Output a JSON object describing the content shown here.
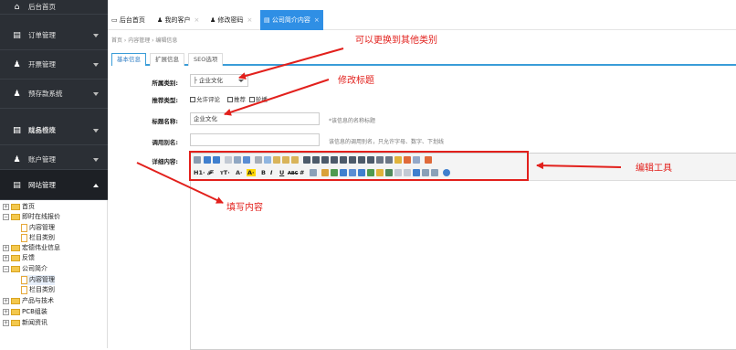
{
  "sidebar": {
    "items": [
      {
        "label": "后台首页",
        "icon": "home-icon"
      },
      {
        "label": "订单管理",
        "icon": "document-icon"
      },
      {
        "label": "开票管理",
        "icon": "user-icon"
      },
      {
        "label": "预存款系统",
        "icon": "user-icon"
      },
      {
        "label": "成品仓库",
        "icon": "document-icon"
      },
      {
        "label": "财务模块",
        "icon": "document-icon"
      },
      {
        "label": "账户管理",
        "icon": "user-icon"
      },
      {
        "label": "网站管理",
        "icon": "document-icon"
      }
    ]
  },
  "tree": [
    {
      "label": "首页",
      "type": "folder",
      "toggle": "+"
    },
    {
      "label": "即时在线报价",
      "type": "folder",
      "toggle": "−"
    },
    {
      "label": "内容管理",
      "type": "doc"
    },
    {
      "label": "栏目类别",
      "type": "doc"
    },
    {
      "label": "宏德伟业信息",
      "type": "folder",
      "toggle": "+"
    },
    {
      "label": "反馈",
      "type": "folder",
      "toggle": "+"
    },
    {
      "label": "公司简介",
      "type": "folder",
      "toggle": "−"
    },
    {
      "label": "内容管理",
      "type": "doc",
      "selected": true
    },
    {
      "label": "栏目类别",
      "type": "doc"
    },
    {
      "label": "产品与技术",
      "type": "folder",
      "toggle": "+"
    },
    {
      "label": "PCB组装",
      "type": "folder",
      "toggle": "+"
    },
    {
      "label": "新闻资讯",
      "type": "folder",
      "toggle": "+"
    }
  ],
  "tabs": [
    {
      "label": "后台首页",
      "icon": "monitor-icon",
      "closable": false
    },
    {
      "label": "我的客户",
      "icon": "user-icon",
      "closable": true
    },
    {
      "label": "修改密码",
      "icon": "user-icon",
      "closable": true
    },
    {
      "label": "公司简介内容",
      "icon": "document-icon",
      "closable": true,
      "active": true
    }
  ],
  "close_glyph": "×",
  "breadcrumb": "首页 › 内容管理 › 编辑信息",
  "subtabs": [
    "基本信息",
    "扩展信息",
    "SEO选项"
  ],
  "form": {
    "category_label": "所属类别:",
    "category_value": "├ 企业文化",
    "recommend_label": "推荐类型:",
    "recommend_options": [
      "允许评论",
      "推荐",
      "轮播"
    ],
    "title_label": "标题名称:",
    "title_value": "企业文化",
    "title_hint": "*该信息的名称标题",
    "alias_label": "调用别名:",
    "alias_value": "",
    "alias_hint": "该信息的调用别名，只允许字母、数字、下划线",
    "content_label": "详细内容:"
  },
  "toolbar_text": {
    "h1": "H1·",
    "f": "𝓕·",
    "tt": "тT·",
    "a1": "A·",
    "a2": "A·",
    "b": "B",
    "i": "I",
    "u": "U",
    "abc": "ABC",
    "hash": "#"
  },
  "annotations": {
    "category": "可以更换到其他类别",
    "title": "修改标题",
    "toolbar": "编辑工具",
    "content": "填写内容"
  },
  "colors": {
    "sidebar_bg": "#2b2f35",
    "active_tab": "#2f8fe5",
    "annotation": "#e2201c"
  }
}
